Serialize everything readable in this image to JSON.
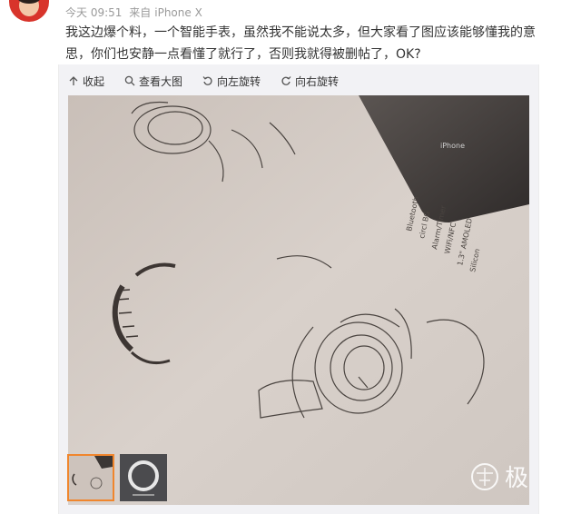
{
  "post": {
    "time": "今天 09:51",
    "source_prefix": "来自",
    "device": "iPhone X",
    "text": "我这边爆个料，一个智能手表，虽然我不能说太多，但大家看了图应该能够懂我的意思，你们也安静一点看懂了就行了，否则我就得被删帖了，OK?"
  },
  "toolbar": {
    "collapse_label": "收起",
    "view_large_label": "查看大图",
    "rotate_left_label": "向左旋转",
    "rotate_right_label": "向右旋转"
  },
  "photo": {
    "phone_brand": "iPhone",
    "notes_lines": [
      "Bluetooth",
      "circl BG",
      "Alarm/Timer",
      "WiFi/NFC",
      "1.3\" AMOLED",
      "Silicon"
    ]
  },
  "watermark": {
    "text": "极"
  },
  "colors": {
    "thumb_active_border": "#f0862d",
    "meta_gray": "#9a9a9a"
  }
}
